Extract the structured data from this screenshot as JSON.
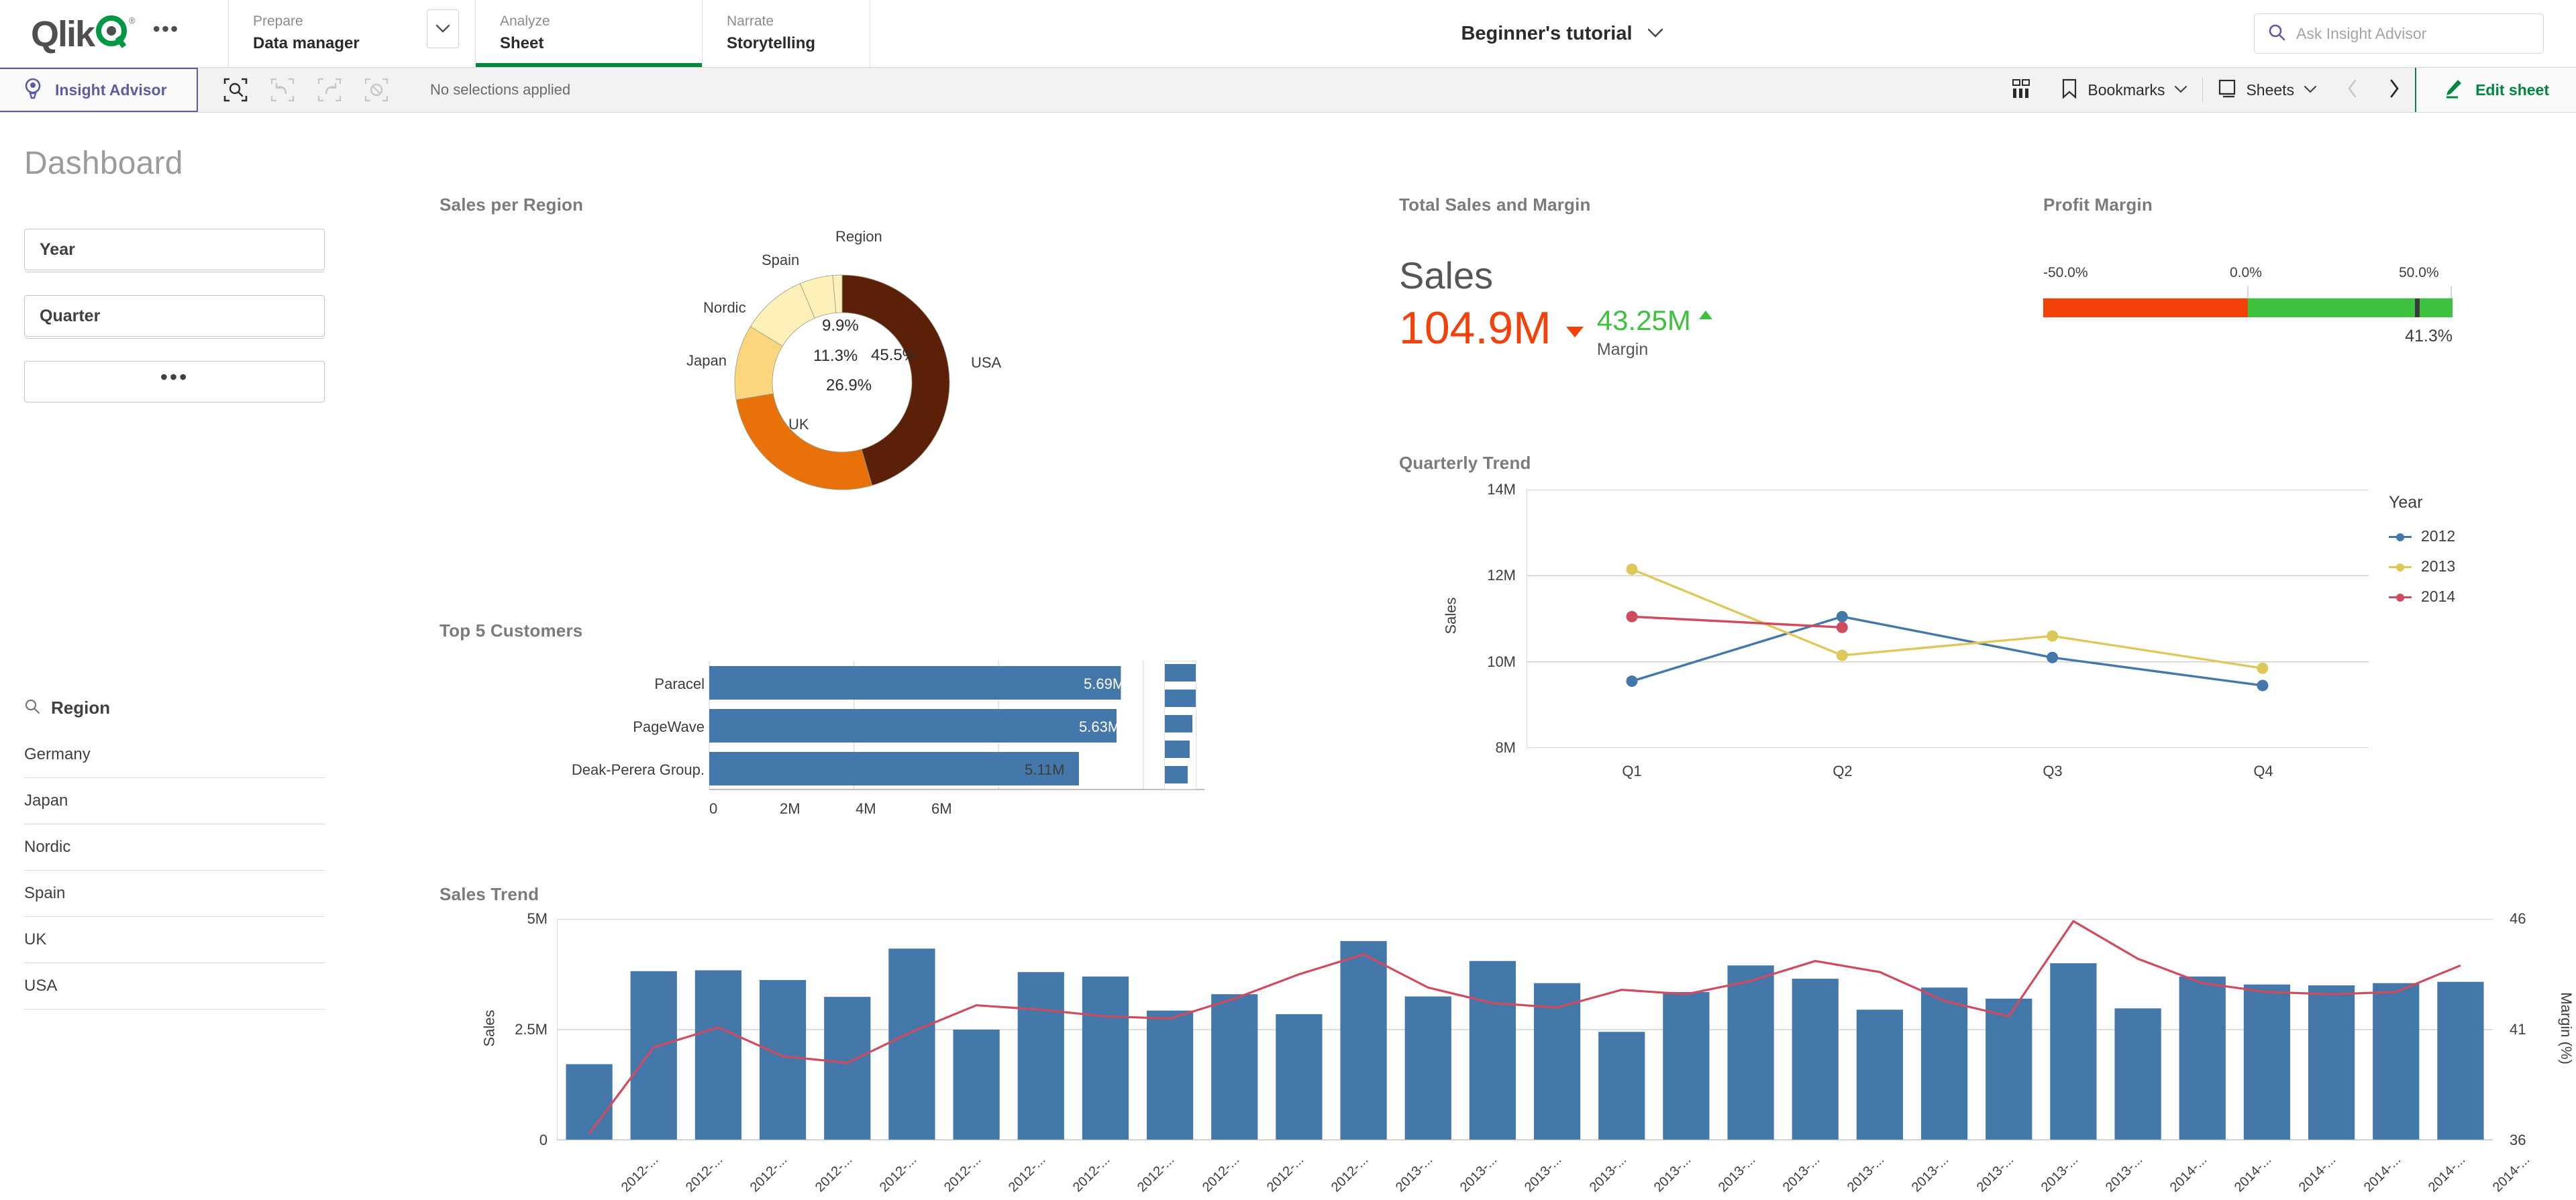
{
  "nav": {
    "logo_text": "Qlik",
    "logo_icon": "qlik-logo",
    "more_icon": "ellipsis-icon",
    "sections": [
      {
        "top": "Prepare",
        "bottom": "Data manager",
        "active": false
      },
      {
        "top": "Analyze",
        "bottom": "Sheet",
        "active": true
      },
      {
        "top": "Narrate",
        "bottom": "Storytelling",
        "active": false
      }
    ],
    "app_title": "Beginner's tutorial",
    "app_title_caret": "chevron-down-icon",
    "search_placeholder": "Ask Insight Advisor",
    "search_icon": "search-icon"
  },
  "toolbar": {
    "insight_advisor_label": "Insight Advisor",
    "insight_advisor_icon": "lightbulb-pin-icon",
    "selection_tool_icon": "selection-search-icon",
    "undo_icon": "undo-arrow-icon",
    "redo_icon": "redo-arrow-icon",
    "clear_icon": "clear-selections-icon",
    "selections_status": "No selections applied",
    "sheet_grid_icon": "sheet-grid-icon",
    "bookmarks_label": "Bookmarks",
    "bookmarks_icon": "bookmark-icon",
    "sheets_label": "Sheets",
    "sheets_icon": "sheet-icon",
    "prev_icon": "chevron-left-icon",
    "next_icon": "chevron-right-icon",
    "edit_sheet_label": "Edit sheet",
    "edit_sheet_icon": "pencil-icon"
  },
  "sidebar": {
    "page_title": "Dashboard",
    "filters": [
      {
        "label": "Year"
      },
      {
        "label": "Quarter"
      }
    ],
    "more_filters_label": "...",
    "region_header": "Region",
    "region_search_icon": "search-icon",
    "region_values": [
      "Germany",
      "Japan",
      "Nordic",
      "Spain",
      "UK",
      "USA"
    ]
  },
  "panels": {
    "sales_per_region": "Sales per Region",
    "top_5_customers": "Top 5 Customers",
    "sales_trend": "Sales Trend",
    "total_sales_margin": "Total Sales and Margin",
    "profit_margin": "Profit Margin",
    "quarterly_trend": "Quarterly Trend"
  },
  "kpi": {
    "sales_label": "Sales",
    "sales_value": "104.9M",
    "sales_trend_direction": "down",
    "sales_color": "#f4410a",
    "margin_value": "43.25M",
    "margin_label": "Margin",
    "margin_trend_direction": "up",
    "margin_color": "#3ec13e"
  },
  "chart_data": [
    {
      "type": "pie",
      "id": "sales-per-region",
      "title": "Sales per Region",
      "legend_title": "Region",
      "labels": [
        "USA",
        "UK",
        "Japan",
        "Nordic",
        "Spain",
        "Germany"
      ],
      "values": [
        45.5,
        26.9,
        11.3,
        9.9,
        5.0,
        1.4
      ],
      "value_labels": [
        "45.5%",
        "26.9%",
        "11.3%",
        "9.9%",
        "",
        ""
      ],
      "colors": [
        "#5c2008",
        "#e8710a",
        "#fcd57f",
        "#fdf0b8",
        "#fdf0b8",
        "#fdf0b8"
      ],
      "donut": true
    },
    {
      "type": "bar",
      "id": "top-5-customers",
      "title": "Top 5 Customers",
      "orientation": "horizontal",
      "categories": [
        "Paracel",
        "PageWave",
        "Deak-Perera Group."
      ],
      "values": [
        5.69,
        5.63,
        5.11
      ],
      "value_labels": [
        "5.69M",
        "5.63M",
        "5.11M"
      ],
      "xlabel": "",
      "ylabel": "",
      "xticks": [
        "0",
        "2M",
        "4M",
        "6M"
      ],
      "xlim": [
        0,
        6.4
      ],
      "bar_color": "#4477aa",
      "scrollbar_total": 5,
      "scrollbar_values": [
        5.69,
        5.63,
        5.11,
        4.6,
        4.2
      ]
    },
    {
      "type": "line",
      "id": "quarterly-trend",
      "title": "Quarterly Trend",
      "categories": [
        "Q1",
        "Q2",
        "Q3",
        "Q4"
      ],
      "xlabel": "",
      "ylabel": "Sales",
      "yticks": [
        "8M",
        "10M",
        "12M",
        "14M"
      ],
      "ylim": [
        8,
        14
      ],
      "legend_title": "Year",
      "legend_position": "right",
      "series": [
        {
          "name": "2012",
          "color": "#4477aa",
          "values": [
            9.55,
            11.05,
            10.1,
            9.45
          ]
        },
        {
          "name": "2013",
          "color": "#ddc85b",
          "values": [
            12.15,
            10.15,
            10.6,
            9.85
          ]
        },
        {
          "name": "2014",
          "color": "#d14b5e",
          "values": [
            11.05,
            10.8,
            null,
            null
          ]
        }
      ]
    },
    {
      "type": "bar",
      "id": "sales-trend",
      "title": "Sales Trend",
      "xlabel": "",
      "ylabel": "Sales",
      "y2label": "Margin (%)",
      "yticks": [
        "0",
        "2.5M",
        "5M"
      ],
      "ylim": [
        0,
        5
      ],
      "y2ticks": [
        "36",
        "41",
        "46"
      ],
      "y2lim": [
        36,
        46
      ],
      "bar_color": "#4477aa",
      "line_color": "#d14b5e",
      "categories": [
        "2012-...",
        "2012-...",
        "2012-...",
        "2012-...",
        "2012-...",
        "2012-...",
        "2012-...",
        "2012-...",
        "2012-...",
        "2012-...",
        "2012-...",
        "2012-...",
        "2013-...",
        "2013-...",
        "2013-...",
        "2013-...",
        "2013-...",
        "2013-...",
        "2013-...",
        "2013-...",
        "2013-...",
        "2013-...",
        "2013-...",
        "2013-...",
        "2014-...",
        "2014-...",
        "2014-...",
        "2014-...",
        "2014-...",
        "2014-..."
      ],
      "values": [
        1.72,
        3.82,
        3.84,
        3.62,
        3.24,
        4.33,
        2.5,
        3.8,
        3.7,
        2.93,
        3.3,
        2.85,
        4.5,
        3.25,
        4.05,
        3.55,
        2.45,
        3.35,
        3.95,
        3.65,
        2.95,
        3.45,
        3.2,
        4.0,
        2.98,
        3.7,
        3.52,
        3.5,
        3.55,
        3.58
      ],
      "line_values": [
        36.3,
        40.2,
        41.1,
        39.8,
        39.5,
        40.9,
        42.1,
        41.9,
        41.6,
        41.5,
        42.4,
        43.5,
        44.4,
        42.9,
        42.2,
        42.0,
        42.8,
        42.6,
        43.2,
        44.1,
        43.6,
        42.3,
        41.6,
        45.9,
        44.2,
        43.1,
        42.7,
        42.6,
        42.7,
        43.9
      ]
    },
    {
      "type": "bar",
      "id": "profit-margin-gauge",
      "title": "Profit Margin",
      "ticks": [
        "-50.0%",
        "0.0%",
        "50.0%"
      ],
      "range": [
        -50,
        50
      ],
      "value": 41.3,
      "value_label": "41.3%",
      "negative_color": "#f4410a",
      "positive_color": "#3ec13e"
    }
  ]
}
